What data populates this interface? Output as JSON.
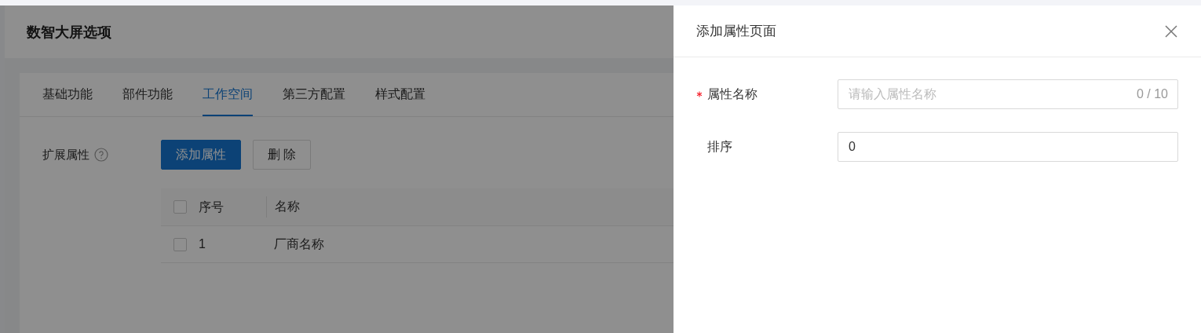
{
  "page": {
    "title": "数智大屏选项"
  },
  "tabs": [
    {
      "label": "基础功能",
      "selected": false
    },
    {
      "label": "部件功能",
      "selected": false
    },
    {
      "label": "工作空间",
      "selected": true
    },
    {
      "label": "第三方配置",
      "selected": false
    },
    {
      "label": "样式配置",
      "selected": false
    }
  ],
  "extension": {
    "label": "扩展属性",
    "buttons": [
      {
        "label": "添加属性",
        "kind": "primary"
      },
      {
        "label": "删 除",
        "kind": "default"
      }
    ]
  },
  "table": {
    "header_checked": false,
    "columns": [
      "序号",
      "名称"
    ],
    "rows": [
      {
        "checked": false,
        "cells": [
          "1",
          "厂商名称"
        ]
      }
    ]
  },
  "drawer": {
    "title": "添加属性页面",
    "fields": [
      {
        "label": "属性名称",
        "required": true,
        "placeholder": "请输入属性名称",
        "counter": "0 / 10"
      },
      {
        "label": "排序",
        "required": false,
        "value": "0"
      }
    ]
  }
}
